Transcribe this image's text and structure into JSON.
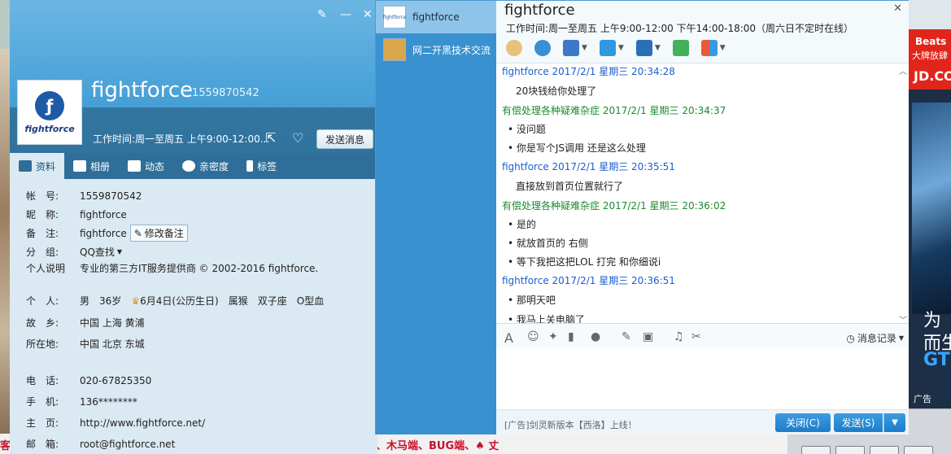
{
  "background": {
    "bottom_text": "、木马端、BUG端、♠ 丈",
    "bottom_left_text": "客"
  },
  "profile": {
    "window_controls": {
      "skin": "✎",
      "minimize": "—",
      "close": "✕"
    },
    "avatar_text": "fightforce",
    "name": "fightforce",
    "qq_number": "1559870542",
    "signature": "工作时间:周一至周五 上午9:00-12:00...",
    "send_button": "发送消息",
    "tabs": [
      {
        "label": "资料",
        "active": true
      },
      {
        "label": "相册",
        "active": false
      },
      {
        "label": "动态",
        "active": false
      },
      {
        "label": "亲密度",
        "active": false
      },
      {
        "label": "标签",
        "active": false
      }
    ],
    "fields": {
      "account_label": "帐　号:",
      "account_value": "1559870542",
      "nickname_label": "昵　称:",
      "nickname_value": "fightforce",
      "remark_label": "备　注:",
      "remark_value": "fightforce",
      "edit_remark": "修改备注",
      "group_label": "分　组:",
      "group_value": "QQ查找",
      "bio_label": "个人说明",
      "bio_value": "专业的第三方IT服务提供商 © 2002-2016 fightforce.",
      "personal_label": "个　人:",
      "personal_value_1": "男",
      "personal_value_2": "36岁",
      "personal_value_3": "6月4日(公历生日)",
      "personal_value_4": "属猴",
      "personal_value_5": "双子座",
      "personal_value_6": "O型血",
      "hometown_label": "故　乡:",
      "hometown_value": "中国 上海 黄浦",
      "location_label": "所在地:",
      "location_value": "中国 北京 东城",
      "phone_label": "电　话:",
      "phone_value": "020-67825350",
      "mobile_label": "手　机:",
      "mobile_value": "136********",
      "homepage_label": "主　页:",
      "homepage_value": "http://www.fightforce.net/",
      "email_label": "邮　箱:",
      "email_value": "root@fightforce.net"
    }
  },
  "chat": {
    "sessions": [
      {
        "name": "fightforce",
        "avatar": "fightforce",
        "active": true
      },
      {
        "name": "网二开黑技术交流",
        "avatar": "",
        "active": false
      }
    ],
    "title": "fightforce",
    "hours": "工作时间:周一至周五 上午9:00-12:00 下午14:00-18:00（周六日不定时在线）",
    "messages": [
      {
        "type": "head",
        "who": "them",
        "text": "fightforce 2017/2/1 星期三 20:34:28"
      },
      {
        "type": "line",
        "text": "20块钱给你处理了"
      },
      {
        "type": "head",
        "who": "me",
        "text": "有偿处理各种疑难杂症 2017/2/1 星期三 20:34:37"
      },
      {
        "type": "line",
        "text": "• 没问题"
      },
      {
        "type": "line",
        "text": "•  你是写个JS调用 还是这么处理"
      },
      {
        "type": "head",
        "who": "them",
        "text": "fightforce 2017/2/1 星期三 20:35:51"
      },
      {
        "type": "line",
        "text": "直接放到首页位置就行了"
      },
      {
        "type": "head",
        "who": "me",
        "text": "有偿处理各种疑难杂症 2017/2/1 星期三 20:36:02"
      },
      {
        "type": "line",
        "text": "• 是的"
      },
      {
        "type": "line",
        "text": "• 就放首页的 右侧"
      },
      {
        "type": "line",
        "text": "• 等下我把这把LOL 打完 和你细说i"
      },
      {
        "type": "head",
        "who": "them",
        "text": "fightforce 2017/2/1 星期三 20:36:51"
      },
      {
        "type": "line",
        "text": "• 那明天吧"
      },
      {
        "type": "line",
        "text": "• 我马上关电脑了"
      }
    ],
    "history_label": "消息记录",
    "ad_text": "[广告]剑灵新版本【西洛】上线！",
    "close_button": "关闭(C)",
    "send_button": "发送(S)"
  },
  "ad_right": {
    "beats": "Beats",
    "beats_sub": "大牌放肆",
    "jd": "JD.CO",
    "line1": "为",
    "line2": "而生",
    "line3": "GT",
    "label": "广告"
  }
}
